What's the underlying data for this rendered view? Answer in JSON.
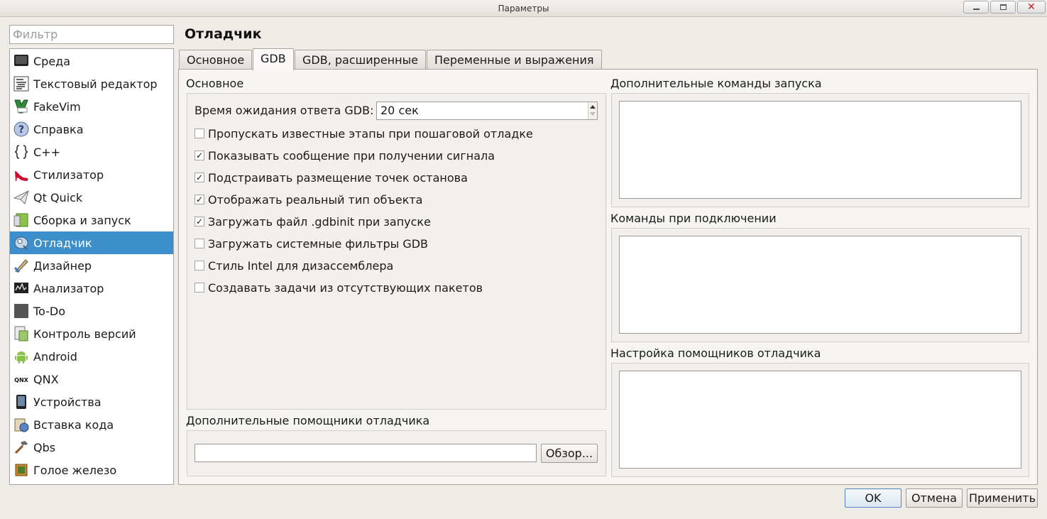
{
  "window": {
    "title": "Параметры",
    "minimize_glyph": "",
    "maximize_glyph": "",
    "close_glyph": "✕"
  },
  "filter": {
    "placeholder": "Фильтр",
    "value": ""
  },
  "sidebar": {
    "items": [
      {
        "label": "Среда",
        "icon": "monitor-icon"
      },
      {
        "label": "Текстовый редактор",
        "icon": "text-editor-icon"
      },
      {
        "label": "FakeVim",
        "icon": "fakevim-icon"
      },
      {
        "label": "Справка",
        "icon": "help-icon"
      },
      {
        "label": "C++",
        "icon": "braces-icon"
      },
      {
        "label": "Стилизатор",
        "icon": "high-heel-icon"
      },
      {
        "label": "Qt Quick",
        "icon": "paper-plane-icon"
      },
      {
        "label": "Сборка и запуск",
        "icon": "build-run-icon"
      },
      {
        "label": "Отладчик",
        "icon": "debugger-icon"
      },
      {
        "label": "Дизайнер",
        "icon": "designer-icon"
      },
      {
        "label": "Анализатор",
        "icon": "analyzer-icon"
      },
      {
        "label": "To-Do",
        "icon": "todo-icon"
      },
      {
        "label": "Контроль версий",
        "icon": "version-control-icon"
      },
      {
        "label": "Android",
        "icon": "android-icon"
      },
      {
        "label": "QNX",
        "icon": "qnx-icon"
      },
      {
        "label": "Устройства",
        "icon": "device-icon"
      },
      {
        "label": "Вставка кода",
        "icon": "code-paste-icon"
      },
      {
        "label": "Qbs",
        "icon": "hammer-icon"
      },
      {
        "label": "Голое железо",
        "icon": "chip-icon"
      }
    ],
    "selected_index": 8,
    "qnx_icon_text": "QNX"
  },
  "page": {
    "title": "Отладчик"
  },
  "tabs": [
    {
      "label": "Основное",
      "active": false
    },
    {
      "label": "GDB",
      "active": true
    },
    {
      "label": "GDB, расширенные",
      "active": false
    },
    {
      "label": "Переменные и выражения",
      "active": false
    }
  ],
  "general": {
    "title": "Основное",
    "timeout_label": "Время ожидания ответа GDB:",
    "timeout_value": "20 сек",
    "checkboxes": [
      {
        "label": "Пропускать известные этапы при пошаговой отладке",
        "checked": false
      },
      {
        "label": "Показывать сообщение при получении сигнала",
        "checked": true
      },
      {
        "label": "Подстраивать размещение точек останова",
        "checked": true
      },
      {
        "label": "Отображать реальный тип объекта",
        "checked": true
      },
      {
        "label": "Загружать файл .gdbinit при запуске",
        "checked": true
      },
      {
        "label": "Загружать системные фильтры GDB",
        "checked": false
      },
      {
        "label": "Стиль Intel для дизассемблера",
        "checked": false
      },
      {
        "label": "Создавать задачи из отсутствующих пакетов",
        "checked": false
      }
    ]
  },
  "helpers": {
    "title": "Дополнительные помощники отладчика",
    "path_value": "",
    "browse_label": "Обзор..."
  },
  "right": {
    "startup_title": "Дополнительные команды запуска",
    "attach_title": "Команды при подключении",
    "customization_title": "Настройка помощников отладчика"
  },
  "buttons": {
    "ok": "OK",
    "cancel": "Отмена",
    "apply": "Применить"
  },
  "colors": {
    "selection": "#3d8fcc",
    "background": "#efebe7",
    "close_glyph": "#c0241c"
  }
}
